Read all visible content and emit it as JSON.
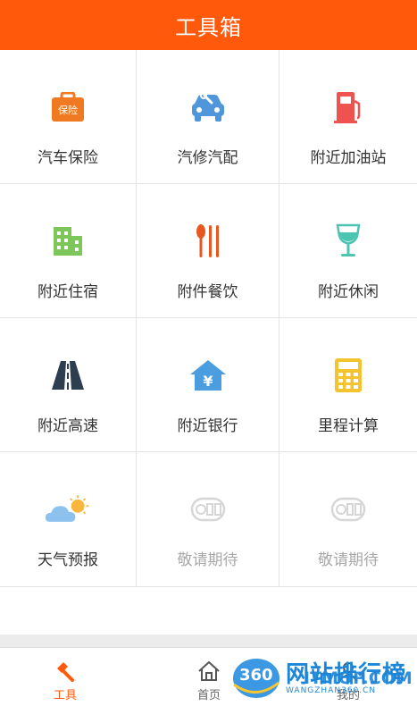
{
  "header": {
    "title": "工具箱"
  },
  "accent_color": "#ff5a0c",
  "tools": [
    {
      "label": "汽车保险",
      "icon": "car-insurance-icon",
      "icon_text": "保险",
      "color": "#f07a22"
    },
    {
      "label": "汽修汽配",
      "icon": "car-repair-icon",
      "color": "#4f97da"
    },
    {
      "label": "附近加油站",
      "icon": "gas-station-icon",
      "color": "#ef5350"
    },
    {
      "label": "附近住宿",
      "icon": "hotel-icon",
      "color": "#7cc65a"
    },
    {
      "label": "附件餐饮",
      "icon": "dining-icon",
      "color": "#e8571f"
    },
    {
      "label": "附近休闲",
      "icon": "wine-glass-icon",
      "color": "#4cc4b2"
    },
    {
      "label": "附近高速",
      "icon": "highway-icon",
      "color": "#2d3e50"
    },
    {
      "label": "附近银行",
      "icon": "bank-icon",
      "color": "#4a9ee0"
    },
    {
      "label": "里程计算",
      "icon": "calculator-icon",
      "color": "#f4c430"
    },
    {
      "label": "天气预报",
      "icon": "weather-icon",
      "color": "#7fb7e6"
    },
    {
      "label": "敬请期待",
      "icon": "coming-soon-icon",
      "color": "#c9c9c9"
    },
    {
      "label": "敬请期待",
      "icon": "coming-soon-icon",
      "color": "#c9c9c9"
    }
  ],
  "tabbar": {
    "tools_label": "工具",
    "home_label": "首页",
    "mine_label": "我的"
  },
  "watermark": {
    "number": "360",
    "text": "网站排行榜",
    "site": "WANGZHAN360.CN",
    "brand": "ITMOP.COM"
  }
}
